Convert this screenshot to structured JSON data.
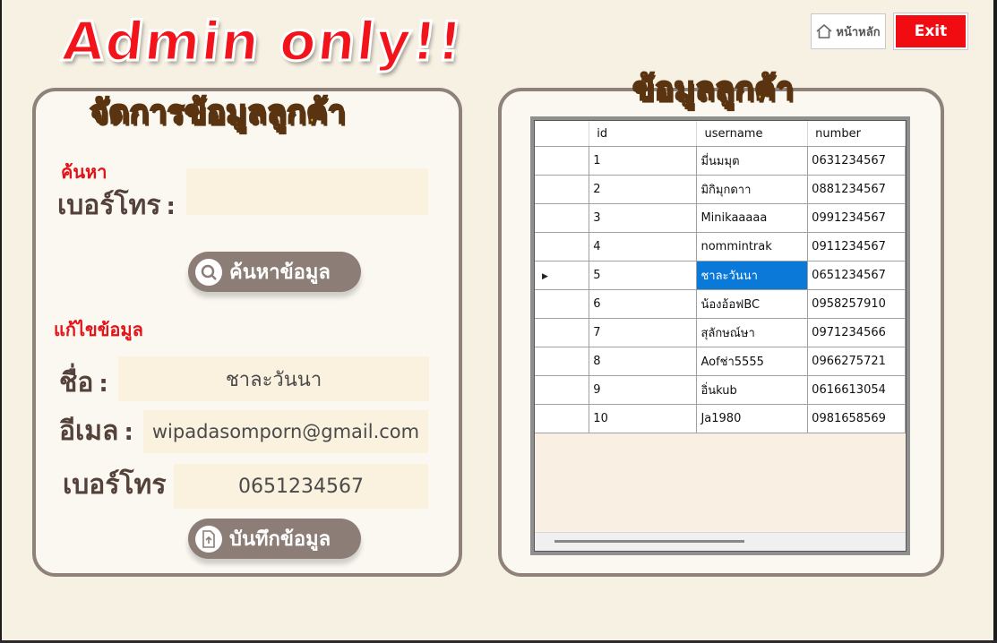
{
  "header": {
    "admin_title": "Admin only!!",
    "home_label": "หน้าหลัก",
    "exit_label": "Exit"
  },
  "left_panel": {
    "title": "จัดการข้อมูลลูกค้า",
    "search_heading": "ค้นหา",
    "phone_label": "เบอร์โทร",
    "phone_search_value": "",
    "search_button": "ค้นหาข้อมูล",
    "edit_heading": "แก้ไขข้อมูล",
    "name_label": "ชื่อ",
    "name_value": "ชาละวันนา",
    "email_label": "อีเมล",
    "email_value": "wipadasomporn@gmail.com",
    "phone2_label": "เบอร์โทร",
    "phone2_value": "0651234567",
    "save_button": "บันทึกข้อมูล",
    "colon": ":"
  },
  "right_panel": {
    "title": "ข้อมูลลูกค้า",
    "columns": [
      "id",
      "username",
      "number"
    ],
    "rows": [
      {
        "id": "1",
        "username": "มี่นมมุต",
        "number": "0631234567"
      },
      {
        "id": "2",
        "username": "มิกิมุกดาา",
        "number": "0881234567"
      },
      {
        "id": "3",
        "username": "Minikaaaaa",
        "number": "0991234567"
      },
      {
        "id": "4",
        "username": "nommintrak",
        "number": "0911234567"
      },
      {
        "id": "5",
        "username": "ชาละวันนา",
        "number": "0651234567"
      },
      {
        "id": "6",
        "username": "น้องอ้อฟBC",
        "number": "0958257910"
      },
      {
        "id": "7",
        "username": "สุลักษณ์ษา",
        "number": "0971234566"
      },
      {
        "id": "8",
        "username": "Aofช่า5555",
        "number": "0966275721"
      },
      {
        "id": "9",
        "username": "อิ่นkub",
        "number": "0616613054"
      },
      {
        "id": "10",
        "username": "Ja1980",
        "number": "0981658569"
      }
    ],
    "selected_row": 4
  },
  "colors": {
    "accent_red": "#f2141a",
    "panel_border": "#8e827a",
    "button_bg": "#8c7d76",
    "selection": "#0a79d7",
    "title_yellow": "#ffd320"
  }
}
